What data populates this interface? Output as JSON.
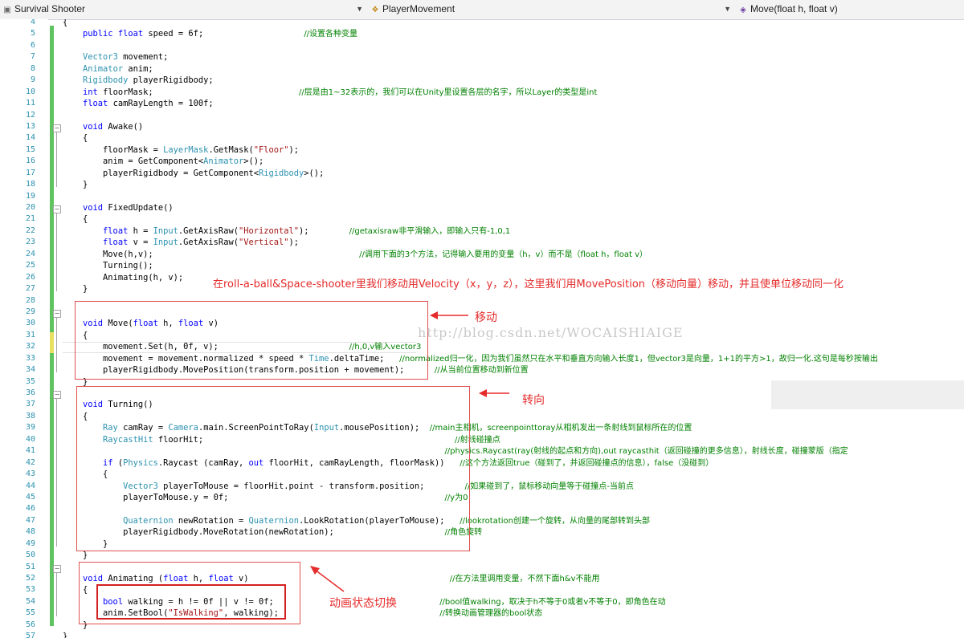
{
  "navbar": {
    "project": "Survival Shooter",
    "class": "PlayerMovement",
    "method": "Move(float h, float v)",
    "project_icon": "csharp-project-icon",
    "class_icon": "class-icon",
    "method_icon": "method-icon"
  },
  "line_numbers": [
    "4",
    "5",
    "6",
    "7",
    "8",
    "9",
    "10",
    "11",
    "12",
    "13",
    "14",
    "15",
    "16",
    "17",
    "18",
    "19",
    "20",
    "21",
    "22",
    "23",
    "24",
    "25",
    "26",
    "27",
    "28",
    "29",
    "30",
    "31",
    "32",
    "33",
    "34",
    "35",
    "36",
    "37",
    "38",
    "39",
    "40",
    "41",
    "42",
    "43",
    "44",
    "45",
    "46",
    "47",
    "48",
    "49",
    "50",
    "51",
    "52",
    "53",
    "54",
    "55",
    "56",
    "57"
  ],
  "comments": {
    "c6": "//设置各种变量",
    "c11": "//层是由1~32表示的，我们可以在Unity里设置各层的名字，所以Layer的类型是int",
    "c22": "//getaxisraw非平滑输入，即输入只有-1,0,1",
    "c24": "//调用下面的3个方法，记得输入要用的变量（h，v）而不是（float h，float v）",
    "c31": "//h,0,v输入vector3",
    "c32": "//normalized归一化，因为我们虽然只在水平和垂直方向输入长度1，但vector3是向量，1+1的平方>1，故归一化.这句是每秒按输出",
    "c33": "//从当前位置移动到新位置",
    "c38": "//main主相机，screenpointtoray从相机发出一条射线到鼠标所在的位置",
    "c39": "//射线碰撞点",
    "c40": "//physics.Raycast(ray(射线的起点和方向),out raycasthit（返回碰撞的更多信息），射线长度，碰撞蒙版（指定",
    "c41": "//这个方法返回true（碰到了，并返回碰撞点的信息），false（没碰到）",
    "c43": "//如果碰到了，鼠标移动向量等于碰撞点-当前点",
    "c44": "//y为0",
    "c46": "//lookrotation创建一个旋转，从向量的尾部转到头部",
    "c47": "//角色旋转",
    "c51": "//在方法里调用变量，不然下面h&v不能用",
    "c53": "//bool值walking，取决于h不等于0或者v不等于0，即角色在动",
    "c54": "//转换动画管理器的bool状态"
  },
  "annotations": {
    "velocity_note": "在roll-a-ball&Space-shooter里我们移动用Velocity（x，y，z），这里我们用MovePosition（移动向量）移动，并且使单位移动同一化",
    "move_label": "移动",
    "turning_label": "转向",
    "anim_label": "动画状态切换",
    "watermark": "http://blog.csdn.net/WOCAISHIAIGE"
  },
  "colors": {
    "keyword": "#0000ff",
    "type": "#2b91af",
    "string": "#a31515",
    "comment": "#008000",
    "annotation": "#e52b2b",
    "change_bar_saved": "#5fc35f",
    "change_bar_unsaved": "#e8e060"
  }
}
